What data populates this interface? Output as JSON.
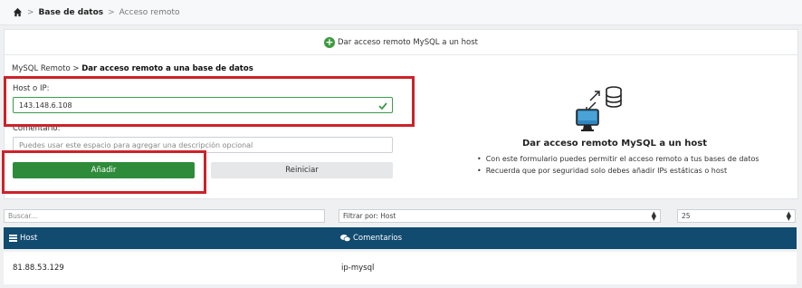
{
  "breadcrumb": {
    "icon": "home-icon",
    "items": [
      "Base de datos",
      "Acceso remoto"
    ],
    "separator": ">"
  },
  "card": {
    "header_label": "Dar acceso remoto MySQL a un host",
    "header_icon": "plus-circle-icon",
    "sub_breadcrumb": {
      "parent": "MySQL Remoto",
      "separator": ">",
      "current": "Dar acceso remoto a una base de datos"
    },
    "host_field": {
      "label": "Host o IP:",
      "value": "143.148.6.108"
    },
    "comment_field": {
      "label": "Comentario:",
      "placeholder": "Puedes usar este espacio para agregar una descripción opcional"
    },
    "add_button": "Añadir",
    "reset_button": "Reiniciar"
  },
  "info": {
    "title": "Dar acceso remoto MySQL a un host",
    "bullets": [
      "Con este formulario puedes permitir el acceso remoto a tus bases de datos",
      "Recuerda que por seguridad solo debes añadir IPs estáticas o host"
    ]
  },
  "filters": {
    "search_placeholder": "Buscar...",
    "filter_select": "Filtrar por: Host",
    "page_size": "25"
  },
  "table": {
    "columns": [
      {
        "label": "Host",
        "icon": "list-icon"
      },
      {
        "label": "Comentarios",
        "icon": "comments-icon"
      }
    ],
    "rows": [
      {
        "host": "81.88.53.129",
        "comment": "ip-mysql"
      }
    ]
  },
  "colors": {
    "primary_green": "#2e8b3a",
    "table_header": "#114b70",
    "highlight_red": "#cc2229"
  }
}
